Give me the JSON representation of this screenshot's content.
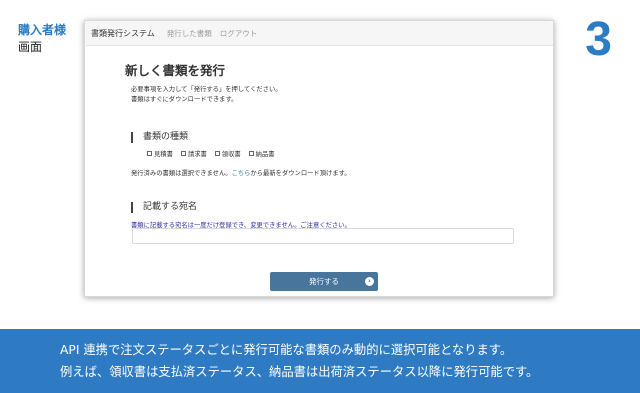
{
  "side_label": {
    "line1": "購入者様",
    "line2": "画面"
  },
  "step_number": "3",
  "app": {
    "brand": "書類発行システム",
    "nav": [
      "発行した書類",
      "ログアウト"
    ]
  },
  "page": {
    "title": "新しく書類を発行",
    "intro": [
      "必要事項を入力して「発行する」を押してください。",
      "書類はすぐにダウンロードできます。"
    ]
  },
  "doc_types": {
    "heading": "書類の種類",
    "options": [
      "見積書",
      "請求書",
      "領収書",
      "納品書"
    ],
    "note_before": "発行済みの書類は選択できません。",
    "note_link": "こちら",
    "note_after": "から最新をダウンロード頂けます。"
  },
  "address": {
    "heading": "記載する宛名",
    "warning": "書類に記載する宛名は一度だけ登録でき、変更できません。ご注意ください。",
    "value": "",
    "placeholder": ""
  },
  "submit": {
    "label": "発行する",
    "icon": "arrow-circle-right-icon"
  },
  "banner": [
    "API 連携で注文ステータスごとに発行可能な書類のみ動的に選択可能となります。",
    "例えば、領収書は支払済ステータス、納品書は出荷済ステータス以降に発行可能です。"
  ],
  "colors": {
    "accent": "#2b7cc4",
    "button": "#47759c",
    "banner": "#2e7bc4",
    "warning_text": "#2a2fb0"
  }
}
